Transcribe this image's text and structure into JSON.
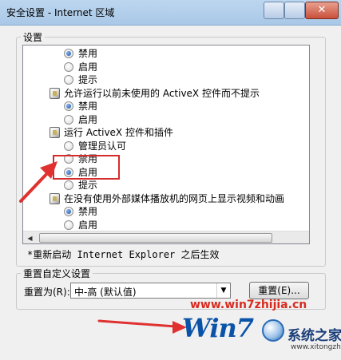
{
  "window": {
    "title": "安全设置 - Internet 区域"
  },
  "settings_group": {
    "title": "设置"
  },
  "settings_list": [
    {
      "kind": "radio",
      "label": "禁用",
      "checked": true
    },
    {
      "kind": "radio",
      "label": "启用",
      "checked": false
    },
    {
      "kind": "radio",
      "label": "提示",
      "checked": false
    },
    {
      "kind": "header",
      "label": "允许运行以前未使用的 ActiveX 控件而不提示"
    },
    {
      "kind": "radio",
      "label": "禁用",
      "checked": true
    },
    {
      "kind": "radio",
      "label": "启用",
      "checked": false
    },
    {
      "kind": "header",
      "label": "运行 ActiveX 控件和插件"
    },
    {
      "kind": "radio",
      "label": "管理员认可",
      "checked": false
    },
    {
      "kind": "radio",
      "label": "禁用",
      "checked": false
    },
    {
      "kind": "radio",
      "label": "启用",
      "checked": true
    },
    {
      "kind": "radio",
      "label": "提示",
      "checked": false
    },
    {
      "kind": "header",
      "label": "在没有使用外部媒体播放机的网页上显示视频和动画"
    },
    {
      "kind": "radio",
      "label": "禁用",
      "checked": true
    },
    {
      "kind": "radio",
      "label": "启用",
      "checked": false
    }
  ],
  "restart_note": "*重新启动 Internet Explorer 之后生效",
  "reset_group": {
    "title": "重置自定义设置",
    "reset_to_label": "重置为(R):",
    "selected_level": "中-高 (默认值)",
    "reset_button": "重置(E)..."
  },
  "watermark": {
    "url": "www.win7zhijia.cn",
    "logo": "Win7",
    "site_name": "系统之家",
    "small_text": "www.xitongzhijia.net"
  },
  "colors": {
    "highlight": "#d62b2b",
    "watermark_red": "#d92b20",
    "watermark_blue": "#0a53a8"
  }
}
